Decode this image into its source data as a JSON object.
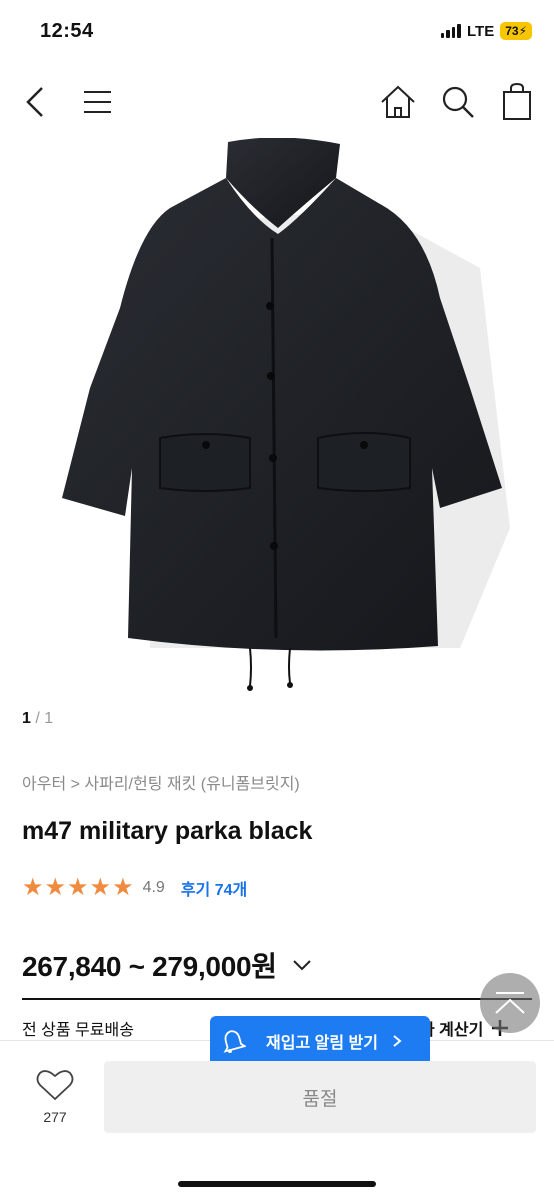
{
  "status_bar": {
    "time": "12:54",
    "network": "LTE",
    "battery": "73"
  },
  "gallery": {
    "current": "1",
    "separator": " / ",
    "total": "1"
  },
  "product": {
    "breadcrumb": "아우터 > 사파리/헌팅 재킷 (유니폼브릿지)",
    "title": "m47 military parka black",
    "stars": [
      "★",
      "★",
      "★",
      "★",
      "★"
    ],
    "rating": "4.9",
    "reviews_label": "후기 74개",
    "price_range": "267,840 ~ 279,000원"
  },
  "info": {
    "shipping": "전 상품 무료배송",
    "calculator": "가 계산기"
  },
  "restock": {
    "label": "재입고 알림 받기"
  },
  "bottom_bar": {
    "wish_count": "277",
    "sold_out": "품절"
  },
  "colors": {
    "accent_blue": "#1e7cf2",
    "star_orange": "#f08a3e",
    "review_blue": "#1a73e8"
  },
  "icons": [
    "back-icon",
    "menu-icon",
    "home-icon",
    "search-icon",
    "bag-icon",
    "star-icon",
    "chevron-down-icon",
    "plus-icon",
    "bell-icon",
    "chevron-right-icon",
    "chevron-up-icon",
    "heart-icon"
  ]
}
